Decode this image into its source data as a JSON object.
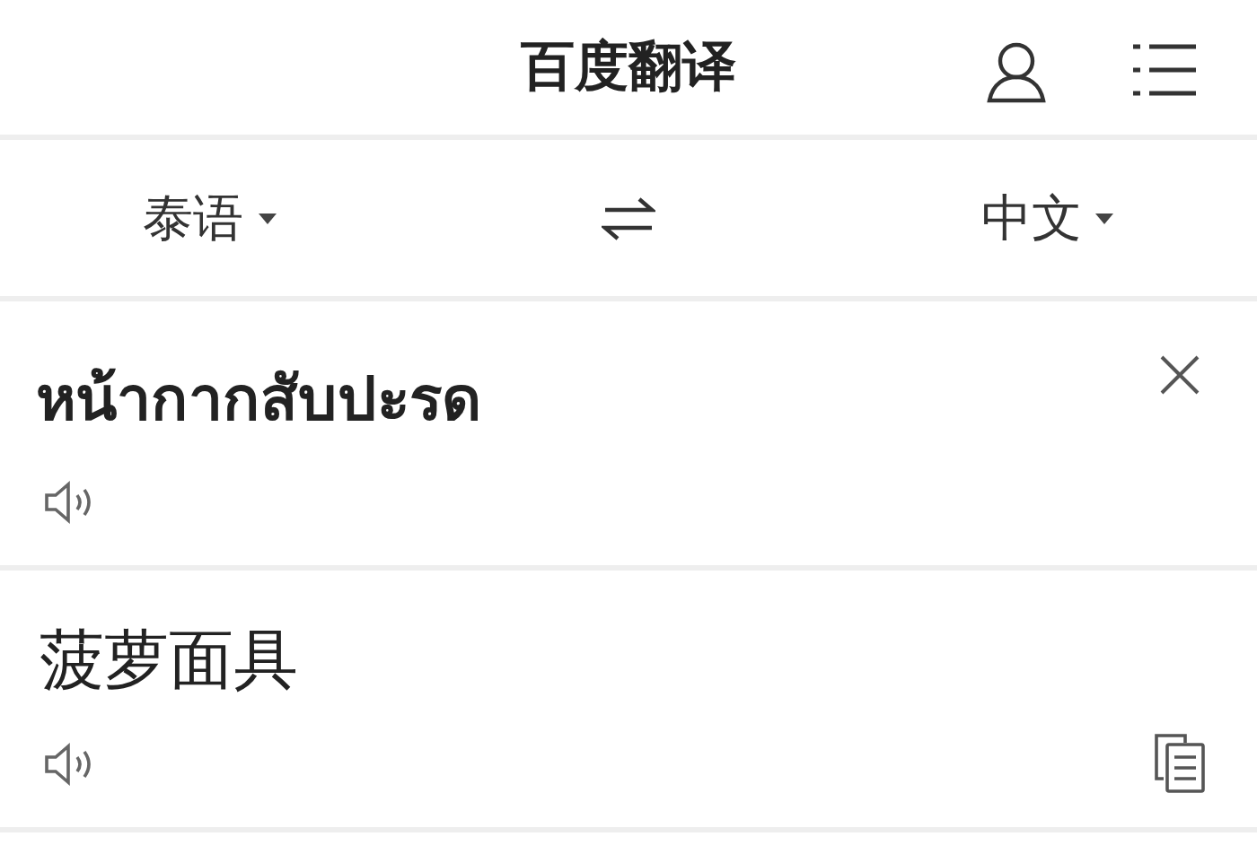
{
  "header": {
    "title": "百度翻译"
  },
  "languages": {
    "source": "泰语",
    "target": "中文"
  },
  "input": {
    "text": "หน้ากากสับปะรด"
  },
  "output": {
    "text": "菠萝面具"
  }
}
